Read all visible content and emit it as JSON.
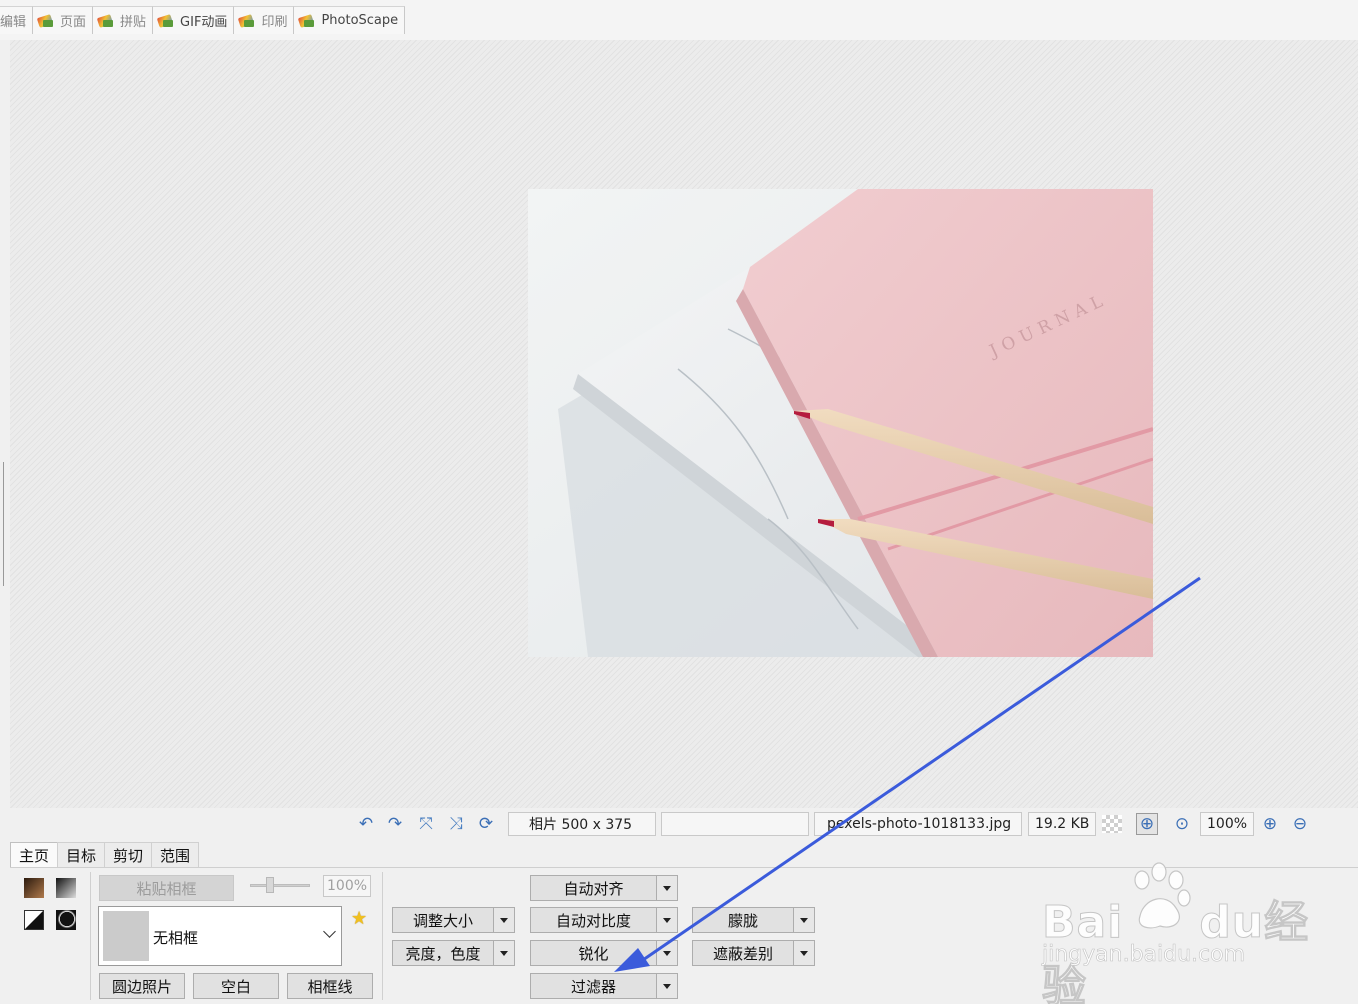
{
  "top_tabs": [
    {
      "label": "编辑",
      "icon": "editor-icon"
    },
    {
      "label": "页面",
      "icon": "page-icon"
    },
    {
      "label": "拼贴",
      "icon": "combine-icon"
    },
    {
      "label": "GIF动画",
      "icon": "gif-icon"
    },
    {
      "label": "印刷",
      "icon": "print-icon"
    },
    {
      "label": "PhotoScape",
      "icon": "photoscape-icon"
    }
  ],
  "photo": {
    "journal_text": "JOURNAL"
  },
  "status": {
    "photo_info": "相片 500 x 375",
    "empty_field": "",
    "filename": "pexels-photo-1018133.jpg",
    "filesize": "19.2 KB",
    "zoom": "100%"
  },
  "panel_tabs": [
    "主页",
    "目标",
    "剪切",
    "范围"
  ],
  "frame": {
    "paste_frame": "粘贴相框",
    "percent": "100%",
    "selected": "无相框",
    "round_photo": "圆边照片",
    "blank": "空白",
    "frame_line": "相框线"
  },
  "buttons": {
    "resize": "调整大小",
    "brightness": "亮度，色度",
    "auto_level": "自动对齐",
    "auto_contrast": "自动对比度",
    "sharpen": "锐化",
    "filter": "过滤器",
    "blur": "朦胧",
    "vignetting": "遮蔽差别"
  },
  "watermark": {
    "brand": "Bai",
    "brand_mid": "du",
    "brand_cn": "经验",
    "url": "jingyan.baidu.com"
  },
  "colors": {
    "accent_arrow": "#3b5bdb",
    "canvas_bg": "#e8e8e8"
  }
}
